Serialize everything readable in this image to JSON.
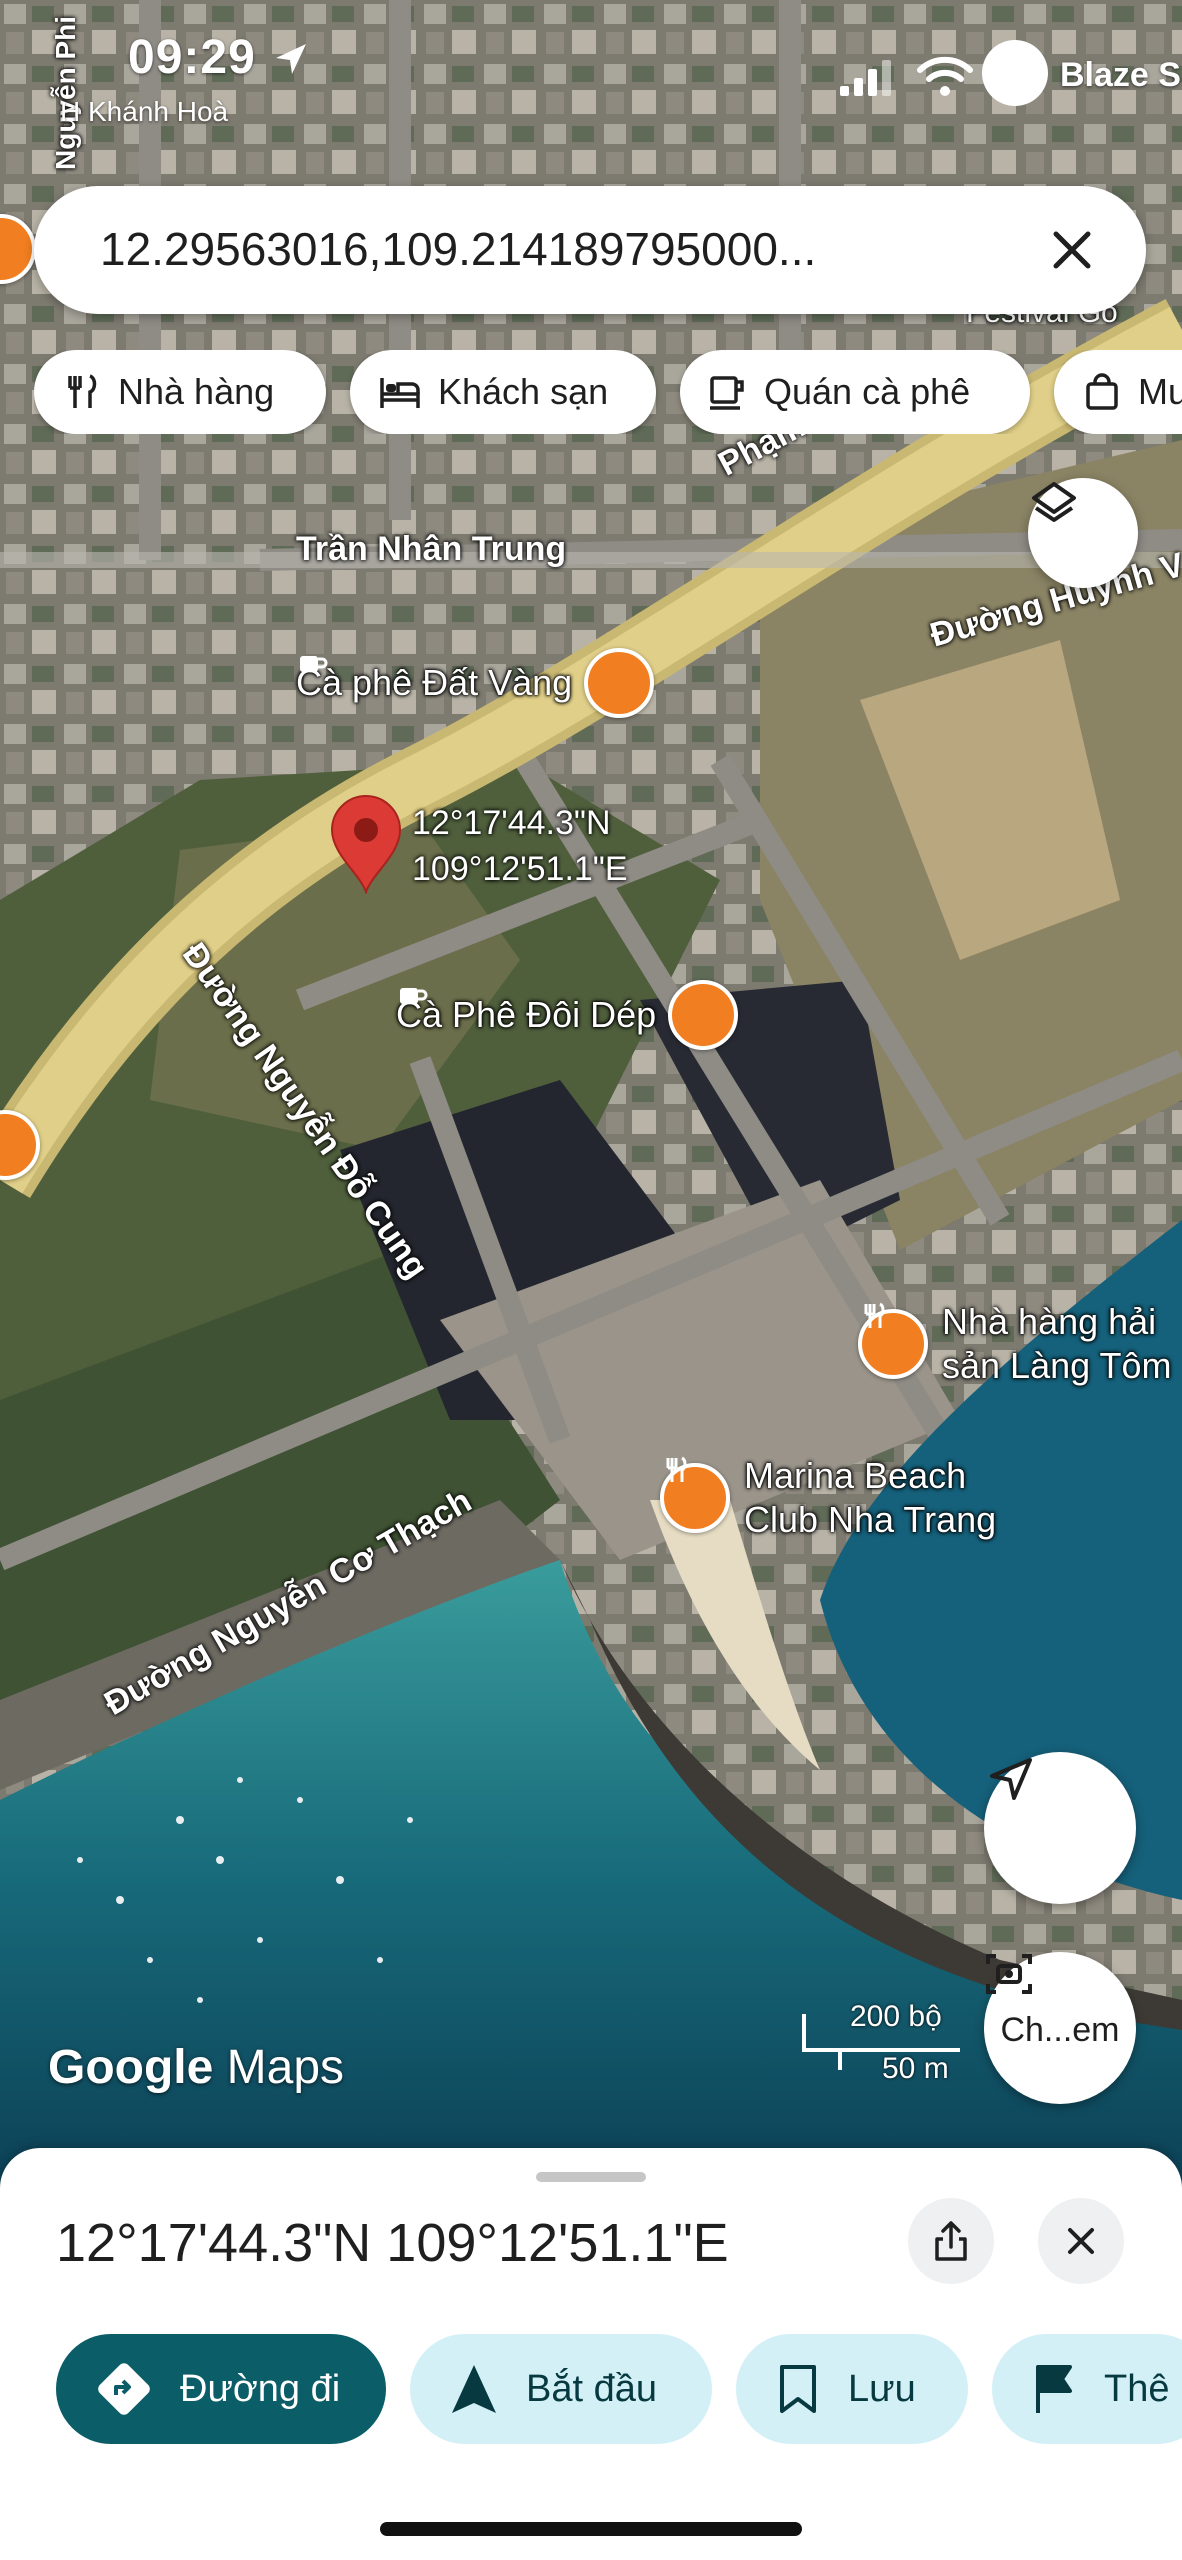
{
  "status_bar": {
    "time": "09:29",
    "subtitle": "H Khánh Hoà",
    "carrier": "Blaze S"
  },
  "search": {
    "value": "12.29563016,109.214189795000..."
  },
  "chips": [
    {
      "label": "Nhà hàng",
      "icon": "restaurant-icon"
    },
    {
      "label": "Khách sạn",
      "icon": "hotel-icon"
    },
    {
      "label": "Quán cà phê",
      "icon": "coffee-icon"
    },
    {
      "label": "Mu",
      "icon": "shopping-bag-icon"
    }
  ],
  "map": {
    "street_labels": [
      "Trần Nhân Trung",
      "Phạm Vă",
      "Đường Huỳnh V",
      "Đường Nguyễn Đỗ Cung",
      "Đường Nguyễn Cơ Thạch",
      "Nguyễn Phi",
      "Festival Go"
    ],
    "pois": [
      {
        "name": "Cà phê Đất Vàng",
        "type": "coffee"
      },
      {
        "name": "Cà Phê Đôi Dép",
        "type": "coffee"
      },
      {
        "name_line1": "Nhà hàng hải",
        "name_line2": "sản Làng Tôm",
        "type": "restaurant"
      },
      {
        "name_line1": "Marina Beach",
        "name_line2": "Club Nha Trang",
        "type": "restaurant"
      }
    ],
    "dropped_pin": {
      "lat": "12°17'44.3\"N",
      "lng": "109°12'51.1\"E"
    },
    "scale": {
      "feet": "200 bộ",
      "meters": "50 m"
    },
    "attribution_google": "Google",
    "attribution_maps": "Maps",
    "lens_label": "Ch...em"
  },
  "sheet": {
    "title": "12°17'44.3\"N 109°12'51.1\"E",
    "actions": [
      {
        "label": "Đường đi",
        "icon": "directions-icon"
      },
      {
        "label": "Bắt đầu",
        "icon": "navigation-icon"
      },
      {
        "label": "Lưu",
        "icon": "bookmark-icon"
      },
      {
        "label": "Thê",
        "icon": "flag-icon"
      }
    ]
  },
  "colors": {
    "primary_action": "#0b5d67",
    "secondary_action": "#d3f0f7",
    "poi_orange": "#f17e20",
    "pin_red": "#db3b34"
  }
}
